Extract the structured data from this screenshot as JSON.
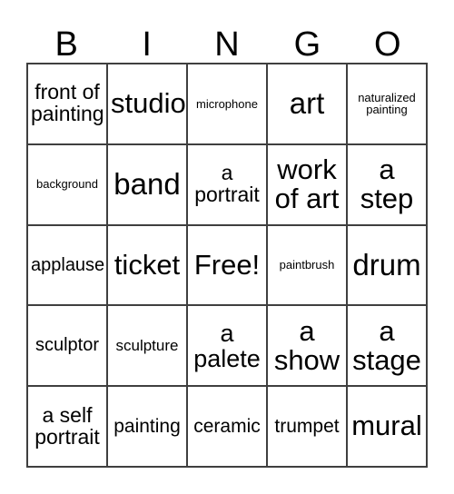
{
  "card": {
    "title": "BINGO",
    "header_letters": [
      "B",
      "I",
      "N",
      "G",
      "O"
    ],
    "grid_size": "5x5",
    "free_space_label": "Free!",
    "colors": {
      "background": "#ffffff",
      "text": "#000000",
      "grid_line": "#3f3f3f"
    },
    "rows": [
      [
        {
          "text": "front of\npainting",
          "size": "lg"
        },
        {
          "text": "studio",
          "size": "xxl"
        },
        {
          "text": "microphone",
          "size": "xs"
        },
        {
          "text": "art",
          "size": "huge"
        },
        {
          "text": "naturalized\npainting",
          "size": "xs"
        }
      ],
      [
        {
          "text": "background",
          "size": "xs"
        },
        {
          "text": "band",
          "size": "huge"
        },
        {
          "text": "a\nportrait",
          "size": "lg"
        },
        {
          "text": "work\nof art",
          "size": "xxl"
        },
        {
          "text": "a\nstep",
          "size": "xxl"
        }
      ],
      [
        {
          "text": "applause",
          "size": "md"
        },
        {
          "text": "ticket",
          "size": "xxl"
        },
        {
          "text": "Free!",
          "size": "xxl"
        },
        {
          "text": "paintbrush",
          "size": "xs"
        },
        {
          "text": "drum",
          "size": "huge"
        }
      ],
      [
        {
          "text": "sculptor",
          "size": "md"
        },
        {
          "text": "sculpture",
          "size": "sm"
        },
        {
          "text": "a\npalete",
          "size": "xl"
        },
        {
          "text": "a\nshow",
          "size": "xxl"
        },
        {
          "text": "a\nstage",
          "size": "xxl"
        }
      ],
      [
        {
          "text": "a self\nportrait",
          "size": "lg"
        },
        {
          "text": "painting",
          "size": "md2"
        },
        {
          "text": "ceramic",
          "size": "md2"
        },
        {
          "text": "trumpet",
          "size": "md2"
        },
        {
          "text": "mural",
          "size": "xxl"
        }
      ]
    ]
  }
}
